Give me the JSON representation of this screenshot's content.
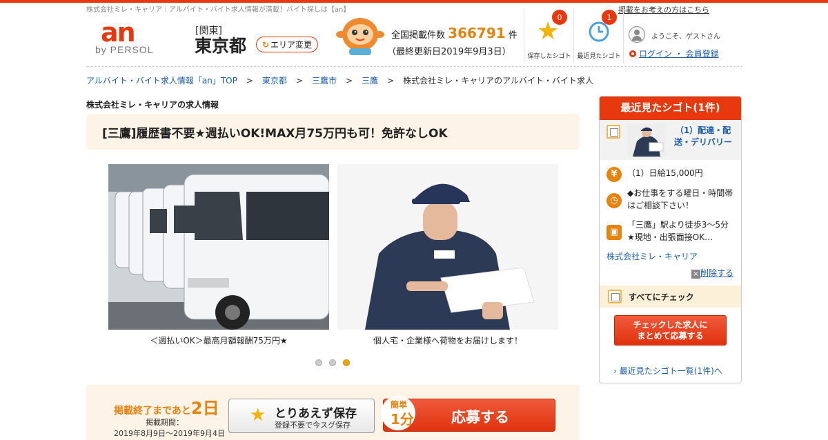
{
  "header": {
    "tagline": "株式会社ミレ・キャリア｜アルバイト・バイト求人情報が満載！バイト探しは【an】",
    "poster_link": "掲載をお考えの方はこちら",
    "logo_main": "an",
    "logo_sub": "by PERSOL",
    "region": "[関東]",
    "prefecture": "東京都",
    "area_change": "エリア変更",
    "count_label": "全国掲載件数",
    "count_value": "366791",
    "count_unit": "件",
    "update": "（最終更新日2019年9月3日）",
    "saved": {
      "label": "保存したシゴト",
      "count": "0"
    },
    "viewed": {
      "label": "最近見たシゴト",
      "count": "1"
    },
    "welcome": "ようこそ、ゲストさん",
    "login": "ログイン ・ 会員登録"
  },
  "breadcrumb": [
    "アルバイト・バイト求人情報「an」TOP",
    "東京都",
    "三鷹市",
    "三鷹",
    "株式会社ミレ・キャリアのアルバイト・バイト求人"
  ],
  "main": {
    "company_heading": "株式会社ミレ・キャリアの求人情報",
    "job_title": "[三鷹]履歴書不要★週払いOK!MAX月75万円も可！免許なしOK",
    "photos": [
      {
        "caption": "＜週払いOK＞最高月額報酬75万円★"
      },
      {
        "caption": "個人宅・企業様へ荷物をお届けします！"
      }
    ],
    "carousel": {
      "count": 3,
      "active": 3
    }
  },
  "apply": {
    "deadline_prefix": "掲載終了まであと",
    "deadline_days": "2日",
    "period_label": "掲載期間：",
    "period": "2019年8月9日～2019年9月4日",
    "save_title": "とりあえず保存",
    "save_sub": "登録不要で今スグ保存",
    "easy_top": "簡単",
    "easy_bottom": "1分",
    "apply_label": "応募する"
  },
  "recent": {
    "header": "最近見たシゴト(1件)",
    "job": "（1）配達・配送・デリバリー",
    "salary": "（1）日給15,000円",
    "hours": "◆お仕事をする曜日・時間帯はご相談下さい！",
    "access": "「三鷹」駅より徒歩3～5分　★現地・出張面接OK…",
    "company": "株式会社ミレ・キャリア",
    "delete": "削除する",
    "check_all": "すべてにチェック",
    "bulk_line1": "チェックした求人に",
    "bulk_line2": "まとめて応募する",
    "list_link": "最近見たシゴト一覧(1件)へ"
  },
  "colors": {
    "brand": "#e8380d",
    "accent": "#e8820d",
    "link": "#1a5dab"
  }
}
